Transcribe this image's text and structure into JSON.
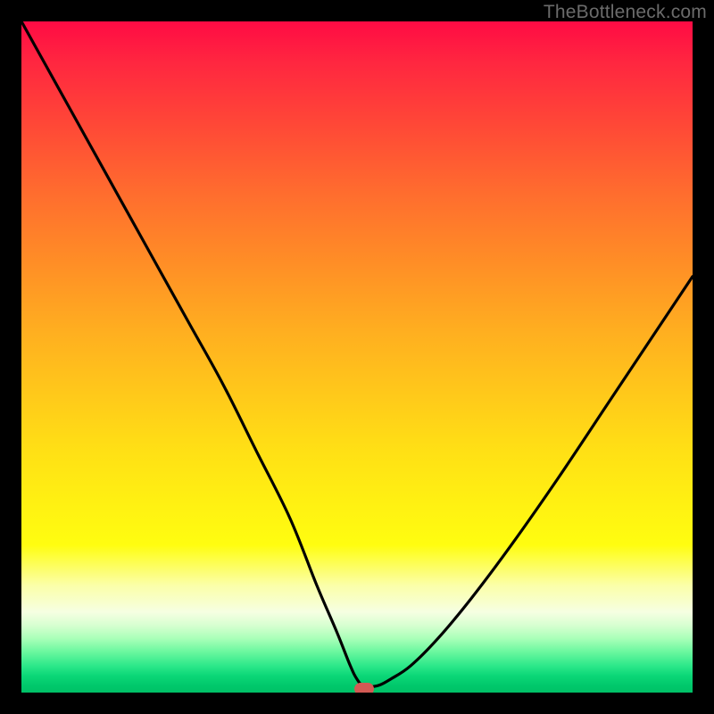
{
  "watermark": "TheBottleneck.com",
  "chart_data": {
    "type": "line",
    "title": "",
    "xlabel": "",
    "ylabel": "",
    "xlim": [
      0,
      100
    ],
    "ylim": [
      0,
      100
    ],
    "series": [
      {
        "name": "bottleneck-curve",
        "x": [
          0,
          5,
          10,
          15,
          20,
          25,
          30,
          35,
          40,
          44,
          47,
          49,
          50,
          51,
          53,
          55,
          58,
          62,
          67,
          73,
          80,
          88,
          96,
          100
        ],
        "y": [
          100,
          91,
          82,
          73,
          64,
          55,
          46,
          36,
          26,
          16,
          9,
          4,
          2,
          1,
          1,
          2,
          4,
          8,
          14,
          22,
          32,
          44,
          56,
          62
        ]
      }
    ],
    "marker": {
      "x": 51,
      "y": 0.5,
      "color": "#d25a54"
    },
    "background_gradient": {
      "top": "#ff0b44",
      "mid": "#ffe015",
      "bottom": "#00c066"
    }
  }
}
